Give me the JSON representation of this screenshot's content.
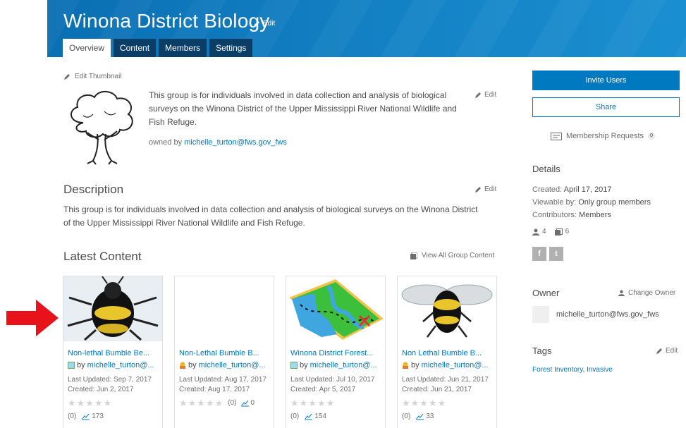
{
  "header": {
    "title": "Winona District Biology",
    "edit_label": "Edit",
    "tabs": [
      "Overview",
      "Content",
      "Members",
      "Settings"
    ],
    "active_tab": "Overview"
  },
  "overview": {
    "edit_thumbnail_label": "Edit Thumbnail",
    "summary": "This group is for individuals involved in data collection and analysis of biological surveys on the Winona District of the Upper Mississippi River National Wildlife and Fish Refuge.",
    "summary_edit_label": "Edit",
    "owned_by_prefix": "owned by",
    "owner": "michelle_turton@fws.gov_fws"
  },
  "description": {
    "heading": "Description",
    "edit_label": "Edit",
    "text": "This group is for individuals involved in data collection and analysis of biological surveys on the Winona District of the Upper Mississippi River National Wildlife and Fish Refuge."
  },
  "latest_content": {
    "heading": "Latest Content",
    "view_all_label": "View All Group Content",
    "items": [
      {
        "title": "Non-lethal Bumble Be...",
        "by": "by",
        "owner": "michelle_turton@...",
        "updated": "Last Updated: Sep 7, 2017",
        "created": "Created: Jun 2, 2017",
        "stars": "★★★★★",
        "ratings": "(0)",
        "views": "173"
      },
      {
        "title": "Non-Lethal Bumble B...",
        "by": "by",
        "owner": "michelle_turton@...",
        "updated": "Last Updated: Aug 17, 2017",
        "created": "Created: Aug 17, 2017",
        "stars": "★★★★★",
        "ratings": "(0)",
        "views": "0"
      },
      {
        "title": "Winona District Forest...",
        "by": "by",
        "owner": "michelle_turton@...",
        "updated": "Last Updated: Jul 10, 2017",
        "created": "Created: Apr 5, 2017",
        "stars": "★★★★★",
        "ratings": "(0)",
        "views": "154"
      },
      {
        "title": "Non Lethal Bumble B...",
        "by": "by",
        "owner": "michelle_turton@...",
        "updated": "Last Updated: Jun 21, 2017",
        "created": "Created: Jun 21, 2017",
        "stars": "★★★★★",
        "ratings": "(0)",
        "views": "33"
      }
    ]
  },
  "sidebar": {
    "invite_label": "Invite Users",
    "share_label": "Share",
    "membership_requests_label": "Membership Requests",
    "membership_requests_count": "0",
    "details_heading": "Details",
    "created_label": "Created:",
    "created_value": "April 17, 2017",
    "viewable_label": "Viewable by:",
    "viewable_value": "Only group members",
    "contributors_label": "Contributors:",
    "contributors_value": "Members",
    "member_count": "4",
    "item_count": "6",
    "facebook_glyph": "f",
    "twitter_glyph": "t",
    "owner_heading": "Owner",
    "change_owner_label": "Change Owner",
    "owner_name": "michelle_turton@fws.gov_fws",
    "tags_heading": "Tags",
    "tags_edit_label": "Edit",
    "tags_value": "Forest Inventory, Invasive"
  },
  "colors": {
    "accent": "#0079c1",
    "banner": "#0a6fb3",
    "tab_dark": "#0a3e66",
    "arrow": "#e8121b"
  },
  "icons": [
    "pencil-icon",
    "tree-thumbnail",
    "view-all-icon",
    "membership-icon",
    "members-icon",
    "items-icon",
    "facebook-icon",
    "twitter-icon",
    "user-icon",
    "red-arrow"
  ]
}
